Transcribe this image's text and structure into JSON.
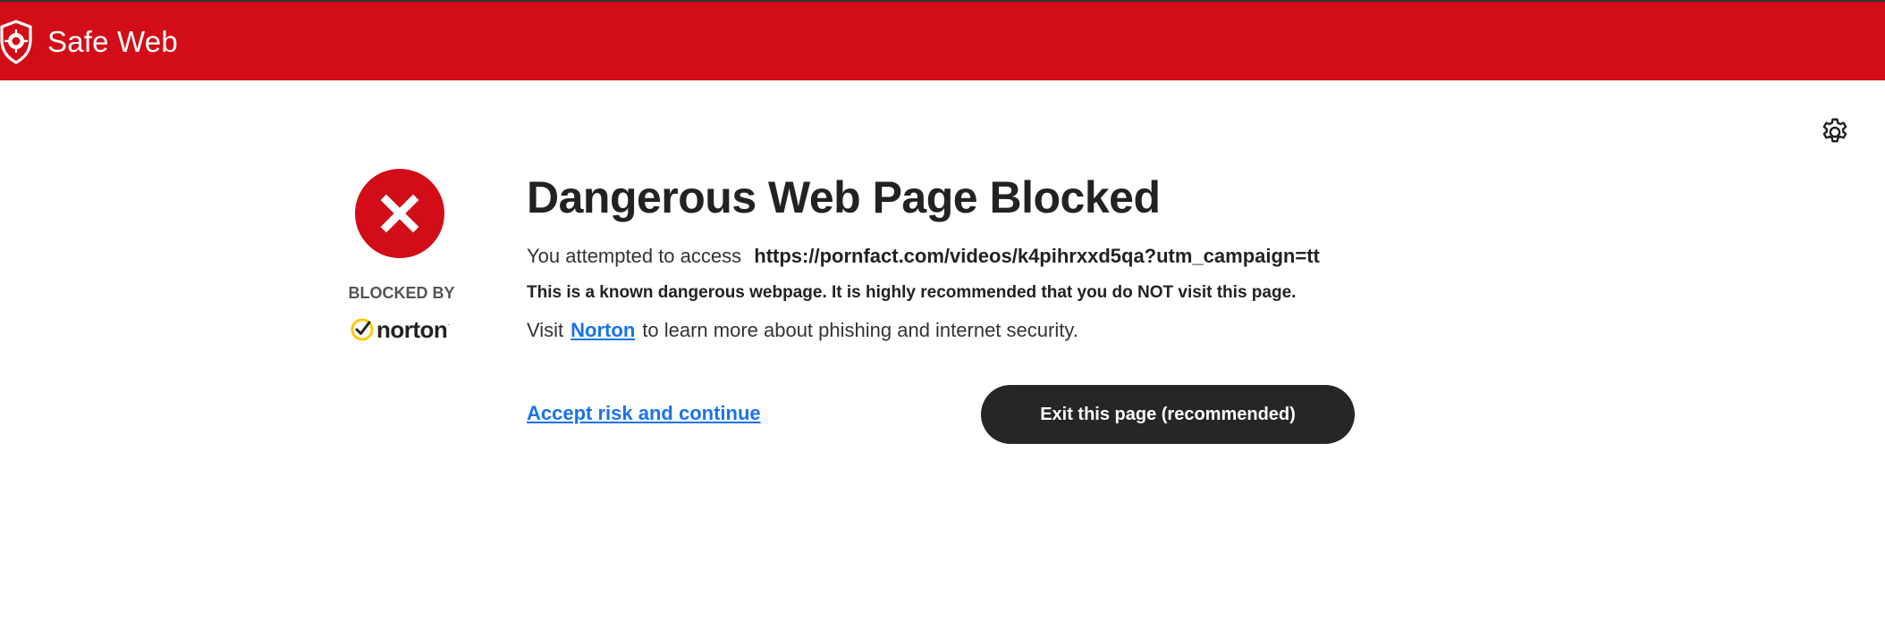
{
  "header": {
    "title": "Safe Web",
    "logo_icon": "shield-icon",
    "background_color": "#d20d17"
  },
  "settings": {
    "icon": "gear-icon"
  },
  "sidebar": {
    "status_icon": "x-circle-icon",
    "blocked_by_label": "BLOCKED BY",
    "brand_name": "norton",
    "brand_icon": "check-circle-icon"
  },
  "main": {
    "heading": "Dangerous Web Page Blocked",
    "attempt_lead": "You attempted to access",
    "attempt_url": "https://pornfact.com/videos/k4pihrxxd5qa?utm_campaign=tt",
    "warning": "This is a known dangerous webpage. It is highly recommended that you do NOT visit this page.",
    "visit_prefix": "Visit",
    "visit_link": "Norton",
    "visit_suffix": "to learn more about phishing and internet security."
  },
  "actions": {
    "accept_label": "Accept risk and continue",
    "exit_label": "Exit this page (recommended)"
  },
  "colors": {
    "brand_red": "#d20d17",
    "link_blue": "#1a73e8",
    "button_dark": "#262626",
    "norton_yellow": "#ffc800"
  }
}
